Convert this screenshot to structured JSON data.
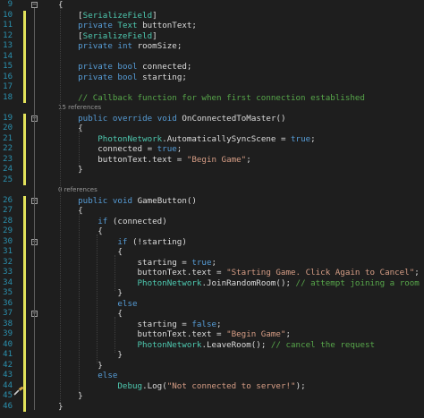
{
  "editor": {
    "change_marker_color": "#e2e25a",
    "keyword_color": "#569cd6",
    "type_color": "#4ec9b0",
    "string_color": "#d69d85",
    "comment_color": "#57a64a",
    "line_number_color": "#2b91af",
    "lines": [
      {
        "num": "9",
        "code": "{"
      },
      {
        "num": "10",
        "code": "    [SerializeField]"
      },
      {
        "num": "11",
        "code": "    private Text buttonText;"
      },
      {
        "num": "12",
        "code": "    [SerializeField]"
      },
      {
        "num": "13",
        "code": "    private int roomSize;"
      },
      {
        "num": "14",
        "code": ""
      },
      {
        "num": "15",
        "code": "    private bool connected;"
      },
      {
        "num": "16",
        "code": "    private bool starting;"
      },
      {
        "num": "17",
        "code": ""
      },
      {
        "num": "18",
        "code": "    // Callback function for when first connection established"
      },
      {
        "num": "",
        "code": "15 references",
        "refs": true
      },
      {
        "num": "19",
        "code": "    public override void OnConnectedToMaster()"
      },
      {
        "num": "20",
        "code": "    {"
      },
      {
        "num": "21",
        "code": "        PhotonNetwork.AutomaticallySyncScene = true;"
      },
      {
        "num": "22",
        "code": "        connected = true;"
      },
      {
        "num": "23",
        "code": "        buttonText.text = \"Begin Game\";"
      },
      {
        "num": "24",
        "code": "    }"
      },
      {
        "num": "25",
        "code": ""
      },
      {
        "num": "",
        "code": "0 references",
        "refs": true
      },
      {
        "num": "26",
        "code": "    public void GameButton()"
      },
      {
        "num": "27",
        "code": "    {"
      },
      {
        "num": "28",
        "code": "        if (connected)"
      },
      {
        "num": "29",
        "code": "        {"
      },
      {
        "num": "30",
        "code": "            if (!starting)"
      },
      {
        "num": "31",
        "code": "            {"
      },
      {
        "num": "32",
        "code": "                starting = true;"
      },
      {
        "num": "33",
        "code": "                buttonText.text = \"Starting Game. Click Again to Cancel\";"
      },
      {
        "num": "34",
        "code": "                PhotonNetwork.JoinRandomRoom(); // attempt joining a room"
      },
      {
        "num": "35",
        "code": "            }"
      },
      {
        "num": "36",
        "code": "            else"
      },
      {
        "num": "37",
        "code": "            {"
      },
      {
        "num": "38",
        "code": "                starting = false;"
      },
      {
        "num": "39",
        "code": "                buttonText.text = \"Begin Game\";"
      },
      {
        "num": "40",
        "code": "                PhotonNetwork.LeaveRoom(); // cancel the request"
      },
      {
        "num": "41",
        "code": "            }"
      },
      {
        "num": "42",
        "code": "        }"
      },
      {
        "num": "43",
        "code": "        else"
      },
      {
        "num": "44",
        "code": "            Debug.Log(\"Not connected to server!\");"
      },
      {
        "num": "45",
        "code": "    }"
      },
      {
        "num": "46",
        "code": "}"
      }
    ]
  }
}
